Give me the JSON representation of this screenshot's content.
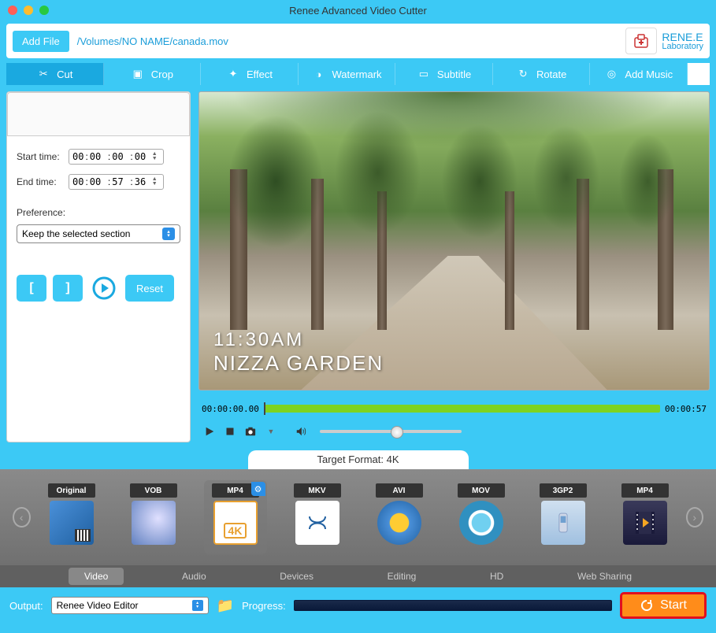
{
  "window": {
    "title": "Renee Advanced Video Cutter"
  },
  "logo": {
    "line1": "RENE.E",
    "line2": "Laboratory"
  },
  "topbar": {
    "add_file": "Add File",
    "filepath": "/Volumes/NO NAME/canada.mov"
  },
  "toolbar": {
    "cut": "Cut",
    "crop": "Crop",
    "effect": "Effect",
    "watermark": "Watermark",
    "subtitle": "Subtitle",
    "rotate": "Rotate",
    "addmusic": "Add Music"
  },
  "cut_panel": {
    "start_label": "Start time:",
    "end_label": "End time:",
    "start": {
      "h": "00",
      "m": "00",
      "s": "00",
      "f": "00"
    },
    "end": {
      "h": "00",
      "m": "00",
      "s": "57",
      "f": "36"
    },
    "pref_label": "Preference:",
    "pref_value": "Keep the selected section",
    "reset": "Reset"
  },
  "preview": {
    "overlay_time": "11:30AM",
    "overlay_place": "NIZZA GARDEN",
    "tc_start": "00:00:00.00",
    "tc_end": "00:00:57"
  },
  "target_format": {
    "label": "Target Format: 4K"
  },
  "formats": {
    "items": [
      {
        "badge": "Original"
      },
      {
        "badge": "VOB"
      },
      {
        "badge": "MP4"
      },
      {
        "badge": "MKV"
      },
      {
        "badge": "AVI"
      },
      {
        "badge": "MOV"
      },
      {
        "badge": "3GP2"
      },
      {
        "badge": "MP4"
      }
    ]
  },
  "categories": {
    "video": "Video",
    "audio": "Audio",
    "devices": "Devices",
    "editing": "Editing",
    "hd": "HD",
    "web": "Web Sharing"
  },
  "bottom": {
    "output_label": "Output:",
    "output_value": "Renee Video Editor",
    "progress_label": "Progress:",
    "start": "Start"
  }
}
